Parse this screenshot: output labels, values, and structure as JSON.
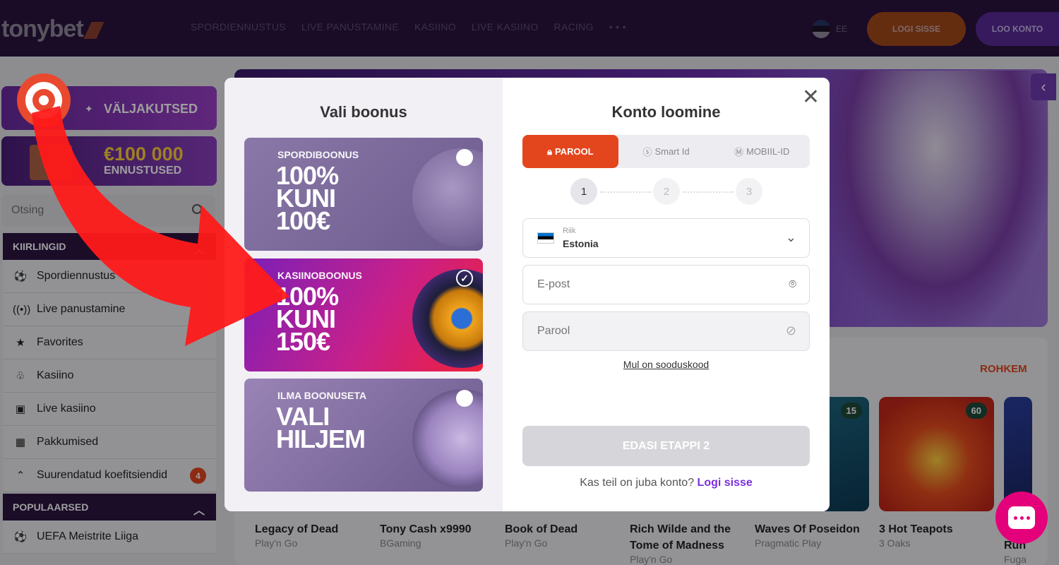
{
  "header": {
    "logo": "tonybet",
    "nav": [
      "SPORDIENNUSTUS",
      "LIVE PANUSTAMINE",
      "KASIINO",
      "LIVE KASIINO",
      "RACING",
      "• • •"
    ],
    "lang": "EE",
    "login": "LOGI SISSE",
    "register": "LOO KONTO"
  },
  "sidebar": {
    "promo_challenges": "VÄLJAKUTSED",
    "promo_prize_amount": "€100 000",
    "promo_prize_label": "ENNUSTUSED",
    "search_placeholder": "Otsing",
    "section_quick": "KIIRLINGID",
    "items": [
      {
        "label": "Spordiennustus",
        "icon": "soccer-icon"
      },
      {
        "label": "Live panustamine",
        "icon": "live-icon"
      },
      {
        "label": "Favorites",
        "icon": "star-icon"
      },
      {
        "label": "Kasiino",
        "icon": "cherry-icon"
      },
      {
        "label": "Live kasiino",
        "icon": "card-icon"
      },
      {
        "label": "Pakkumised",
        "icon": "gift-icon"
      },
      {
        "label": "Suurendatud koefitsiendid",
        "icon": "boost-icon",
        "badge": "4"
      }
    ],
    "section_popular": "POPULAARSED",
    "popular": [
      {
        "label": "UEFA Meistrite Liiga",
        "icon": "soccer-icon"
      }
    ]
  },
  "main": {
    "more": "ROHKEM",
    "games": [
      {
        "name": "Legacy of Dead",
        "provider": "Play'n Go"
      },
      {
        "name": "Tony Cash x9990",
        "provider": "BGaming"
      },
      {
        "name": "Book of Dead",
        "provider": "Play'n Go"
      },
      {
        "name": "Rich Wilde and the Tome of Madness",
        "provider": "Play'n Go"
      },
      {
        "name": "Waves Of Poseidon",
        "provider": "Pragmatic Play",
        "players": "15"
      },
      {
        "name": "3 Hot Teapots",
        "provider": "3 Oaks",
        "players": "60"
      },
      {
        "name": "Run",
        "provider": "Fuga"
      }
    ]
  },
  "modal": {
    "left_title": "Vali boonus",
    "cards": [
      {
        "label": "SPORDIBOONUS",
        "big": "100%\nKUNI\n100€",
        "selected": false
      },
      {
        "label": "KASIINOBOONUS",
        "big": "100%\nKUNI\n150€",
        "selected": true
      },
      {
        "label": "ILMA BOONUSETA",
        "big": "VALI\nHILJEM",
        "selected": false
      }
    ],
    "right_title": "Konto loomine",
    "tabs": [
      "PAROOL",
      "Smart Id",
      "MOBIIL-ID"
    ],
    "steps": [
      "1",
      "2",
      "3"
    ],
    "country_label": "Riik",
    "country_value": "Estonia",
    "email_placeholder": "E-post",
    "password_placeholder": "Parool",
    "promo_code_link": "Mul on sooduskood",
    "next_button": "EDASI ETAPPI 2",
    "have_account": "Kas teil on juba konto?",
    "login_link": "Logi sisse"
  }
}
